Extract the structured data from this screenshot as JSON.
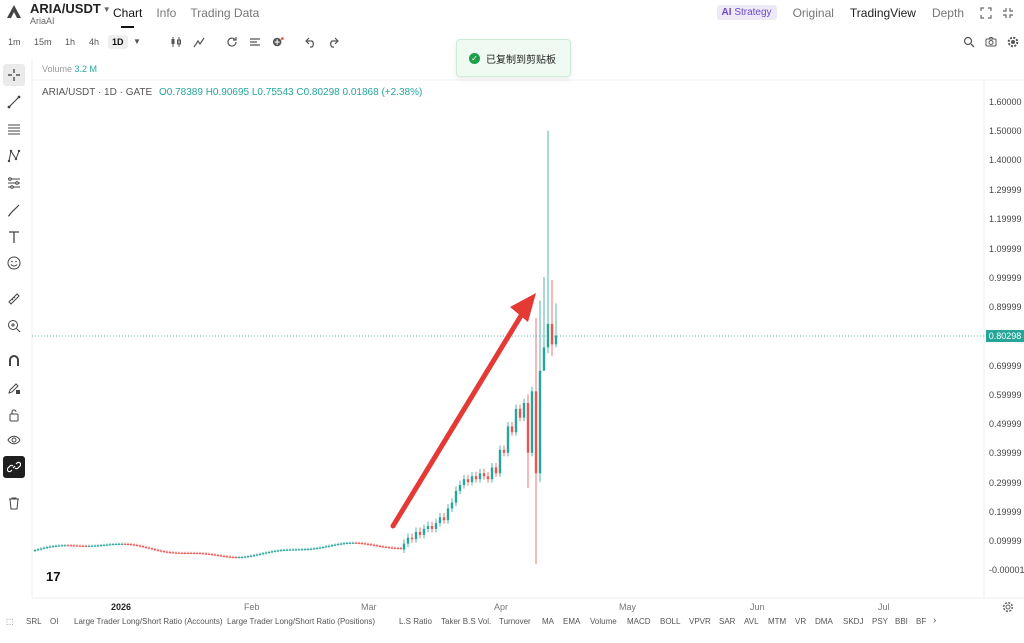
{
  "header": {
    "pair": "ARIA/USDT",
    "name": "AriaAI",
    "tabs": [
      {
        "label": "Chart",
        "active": true
      },
      {
        "label": "Info",
        "active": false
      },
      {
        "label": "Trading Data",
        "active": false
      }
    ],
    "strategy_ai": "AI",
    "strategy_label": "Strategy",
    "views": [
      "Original",
      "TradingView",
      "Depth"
    ]
  },
  "toolbar": {
    "timeframes": [
      "1m",
      "15m",
      "1h",
      "4h",
      "1D"
    ],
    "active_timeframe": "1D"
  },
  "toast": {
    "text": "已复制到剪贴板"
  },
  "chart": {
    "volume_label": "Volume",
    "volume_value": "3.2 M",
    "symbol_line": "ARIA/USDT · 1D · GATE",
    "o": "O0.78389",
    "h": "H0.90695",
    "l": "L0.75543",
    "c": "C0.80298",
    "chg": "0.01868 (+2.38%)",
    "current_price": "0.80298",
    "price_labels": [
      "1.60000",
      "1.50000",
      "1.40000",
      "1.29999",
      "1.19999",
      "1.09999",
      "0.99999",
      "0.89999",
      "0.69999",
      "0.59999",
      "0.49999",
      "0.39999",
      "0.29999",
      "0.19999",
      "0.09999",
      "-0.00001"
    ],
    "x_labels": [
      {
        "label": "2026",
        "bold": true
      },
      {
        "label": "Feb",
        "bold": false
      },
      {
        "label": "Mar",
        "bold": false
      },
      {
        "label": "Apr",
        "bold": false
      },
      {
        "label": "May",
        "bold": false
      },
      {
        "label": "Jun",
        "bold": false
      },
      {
        "label": "Jul",
        "bold": false
      }
    ],
    "colors": {
      "up": "#26a69a",
      "down": "#ef5350",
      "arrow": "#e53935"
    }
  },
  "chart_data": {
    "type": "candlestick",
    "y_axis_range": [
      -1e-05,
      1.6
    ],
    "current_price": 0.80298,
    "x_axis_months": [
      "2026",
      "Feb",
      "Mar",
      "Apr",
      "May",
      "Jun",
      "Jul"
    ]
  },
  "indicators": [
    "SRL",
    "OI",
    "Large Trader Long/Short Ratio (Accounts)",
    "Large Trader Long/Short Ratio (Positions)",
    "L.S Ratio",
    "Taker B.S Vol.",
    "Turnover",
    "MA",
    "EMA",
    "Volume",
    "MACD",
    "BOLL",
    "VPVR",
    "SAR",
    "AVL",
    "MTM",
    "VR",
    "DMA",
    "SKDJ",
    "PSY",
    "BBI",
    "BF"
  ]
}
